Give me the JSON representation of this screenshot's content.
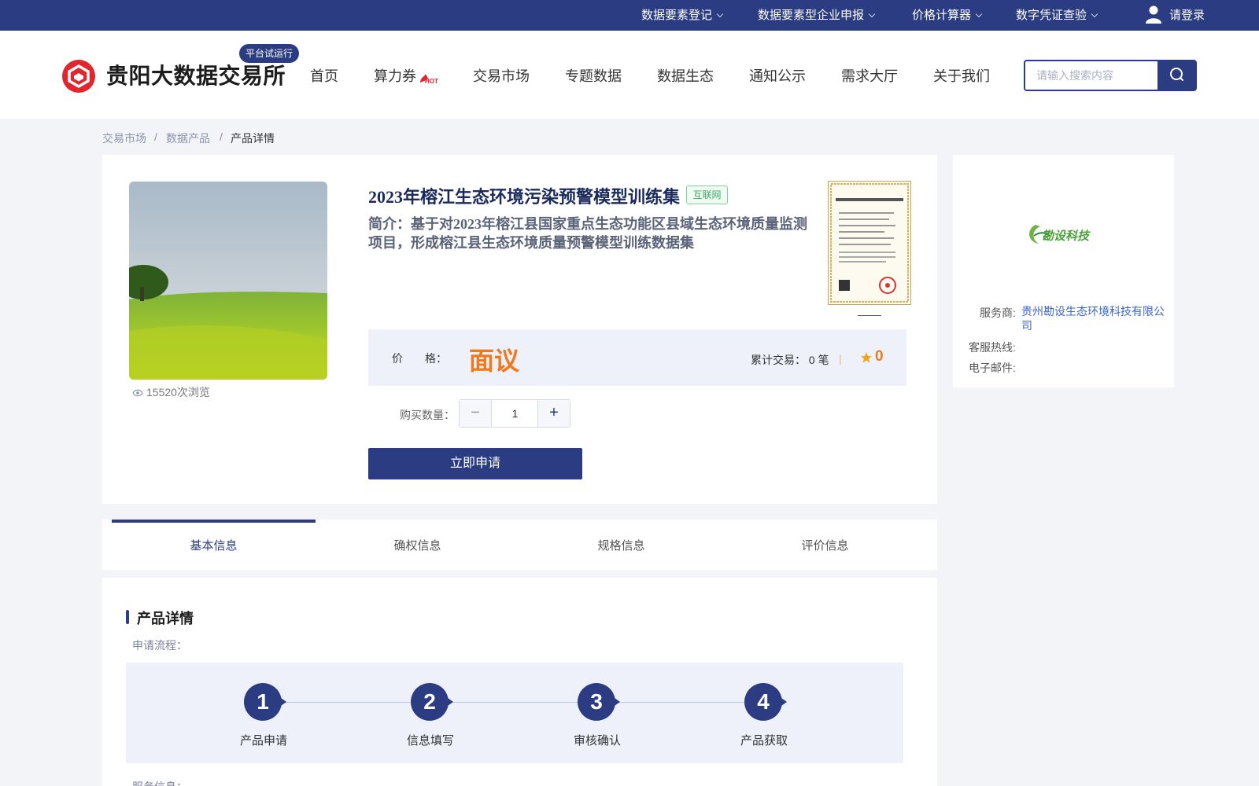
{
  "topbar": {
    "items": [
      "数据要素登记",
      "数据要素型企业申报",
      "价格计算器",
      "数字凭证查验"
    ],
    "login": "请登录"
  },
  "header": {
    "brand": "贵阳大数据交易所",
    "badge": "平台试运行",
    "nav": [
      "首页",
      "算力券",
      "交易市场",
      "专题数据",
      "数据生态",
      "通知公示",
      "需求大厅",
      "关于我们"
    ],
    "hot_icon": "hot-flame-icon",
    "search_placeholder": "请输入搜索内容"
  },
  "breadcrumb": [
    "交易市场",
    "数据产品",
    "产品详情"
  ],
  "product": {
    "title": "2023年榕江生态环境污染预警模型训练集",
    "source_tag": "互联网",
    "intro": "简介：基于对2023年榕江县国家重点生态功能区县域生态环境质量监测项目，形成榕江县生态环境质量预警模型训练数据集",
    "views": "15520次浏览",
    "price_label": "价　　格：",
    "price": "面议",
    "trades": "累计交易：  0 笔",
    "rating": "0",
    "qty_label": "购买数量：",
    "qty": "1",
    "apply": "立即申请"
  },
  "seller": {
    "logo_text": "勘设科技",
    "provider_label": "服务商:",
    "provider": "贵州勘设生态环境科技有限公司",
    "hotline_label": "客服热线:",
    "email_label": "电子邮件:"
  },
  "tabs": [
    "基本信息",
    "确权信息",
    "规格信息",
    "评价信息"
  ],
  "details": {
    "section_title": "产品详情",
    "flow_label": "申请流程：",
    "steps": [
      {
        "num": "1",
        "label": "产品申请"
      },
      {
        "num": "2",
        "label": "信息填写"
      },
      {
        "num": "3",
        "label": "审核确认"
      },
      {
        "num": "4",
        "label": "产品获取"
      }
    ],
    "service_label": "服务信息："
  },
  "colors": {
    "primary": "#2b3c83",
    "price": "#f07a1b",
    "link": "#3b63c7"
  }
}
